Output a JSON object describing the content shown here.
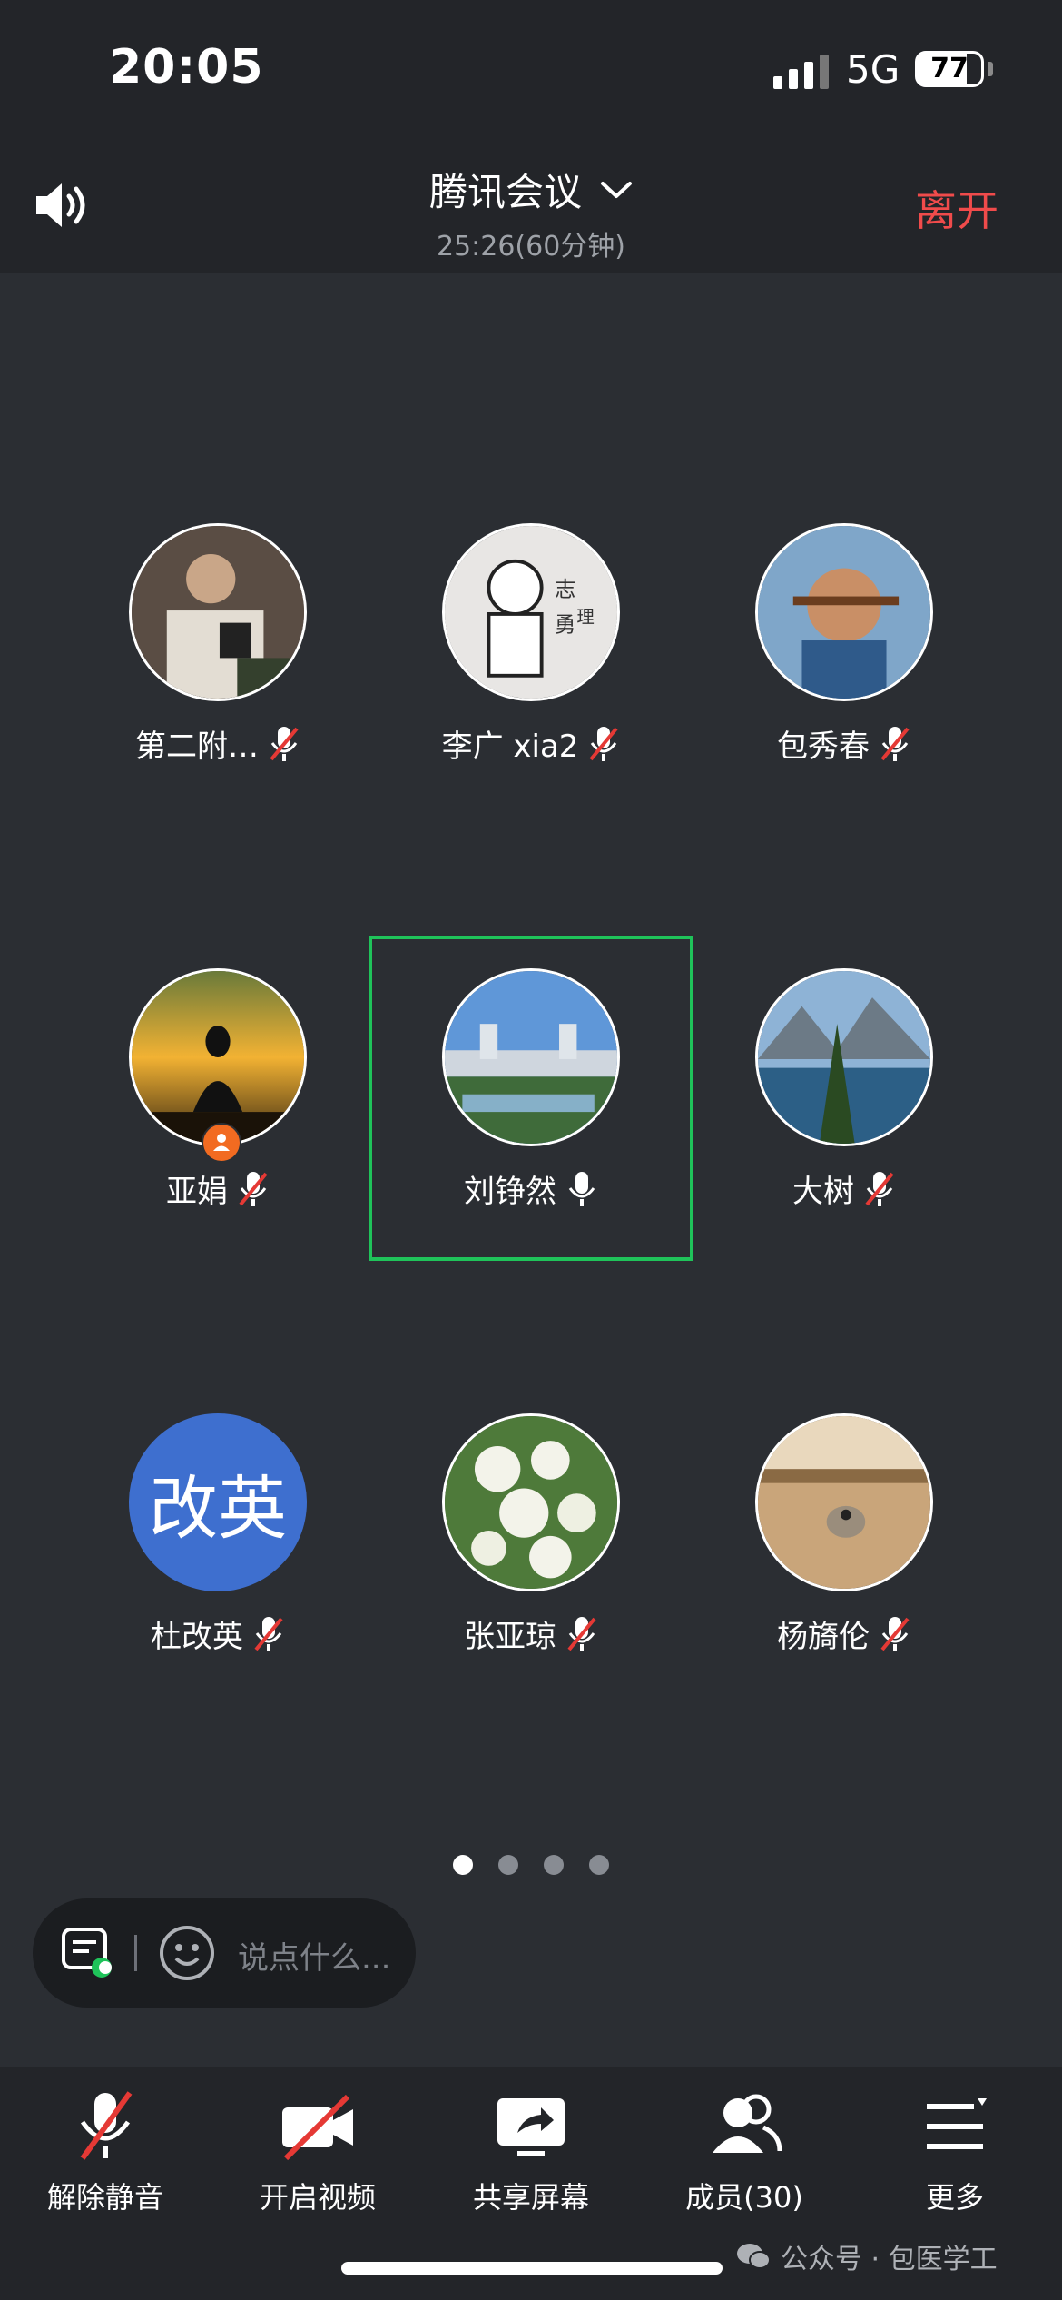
{
  "status_bar": {
    "time": "20:05",
    "network": "5G",
    "battery": "77"
  },
  "header": {
    "title": "腾讯会议",
    "duration": "25:26(60分钟)",
    "leave_label": "离开"
  },
  "participants": [
    {
      "name": "第二附…",
      "mic": "muted"
    },
    {
      "name": "李广 xia2",
      "mic": "muted"
    },
    {
      "name": "包秀春",
      "mic": "muted"
    },
    {
      "name": "亚娟",
      "mic": "muted",
      "host": true
    },
    {
      "name": "刘铮然",
      "mic": "on",
      "speaking": true
    },
    {
      "name": "大树",
      "mic": "muted"
    },
    {
      "name": "杜改英",
      "mic": "muted",
      "avatar_text": "改英"
    },
    {
      "name": "张亚琼",
      "mic": "muted"
    },
    {
      "name": "杨旖伦",
      "mic": "muted"
    }
  ],
  "pagination": {
    "total": 4,
    "current": 1
  },
  "chat": {
    "placeholder": "说点什么..."
  },
  "toolbar": {
    "unmute": "解除静音",
    "start_video": "开启视频",
    "share_screen": "共享屏幕",
    "members": "成员(30)",
    "more": "更多"
  },
  "watermark": "公众号 · 包医学工",
  "colors": {
    "accent_green": "#1fc35a",
    "leave_red": "#f04b4b",
    "avatar_blue": "#3e6fcf"
  }
}
